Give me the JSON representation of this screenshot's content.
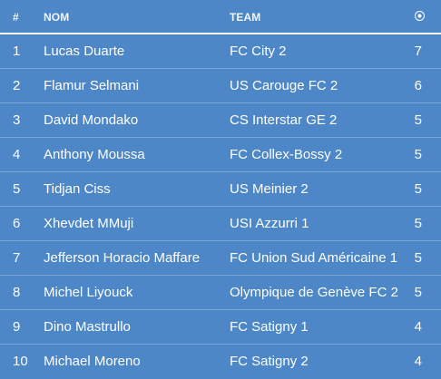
{
  "header": {
    "rank_label": "#",
    "name_label": "NOM",
    "team_label": "TEAM",
    "goals_icon": "soccer-ball-icon"
  },
  "players": [
    {
      "rank": "1",
      "name": "Lucas Duarte",
      "team": "FC City 2",
      "goals": "7"
    },
    {
      "rank": "2",
      "name": "Flamur Selmani",
      "team": "US Carouge FC 2",
      "goals": "6"
    },
    {
      "rank": "3",
      "name": "David Mondako",
      "team": "CS Interstar GE 2",
      "goals": "5"
    },
    {
      "rank": "4",
      "name": "Anthony Moussa",
      "team": "FC Collex-Bossy 2",
      "goals": "5"
    },
    {
      "rank": "5",
      "name": "Tidjan Ciss",
      "team": "US Meinier 2",
      "goals": "5"
    },
    {
      "rank": "6",
      "name": "Xhevdet MMuji",
      "team": "USI Azzurri 1",
      "goals": "5"
    },
    {
      "rank": "7",
      "name": "Jefferson Horacio Maffare",
      "team": "FC Union Sud Américaine 1",
      "goals": "5"
    },
    {
      "rank": "8",
      "name": "Michel Liyouck",
      "team": "Olympique de Genève FC 2",
      "goals": "5"
    },
    {
      "rank": "9",
      "name": "Dino Mastrullo",
      "team": "FC Satigny 1",
      "goals": "4"
    },
    {
      "rank": "10",
      "name": "Michael Moreno",
      "team": "FC Satigny 2",
      "goals": "4"
    }
  ],
  "colors": {
    "background": "#4d87c7",
    "text": "#ffffff",
    "divider": "#7aa5d7",
    "header_divider": "#f4f7fb"
  }
}
